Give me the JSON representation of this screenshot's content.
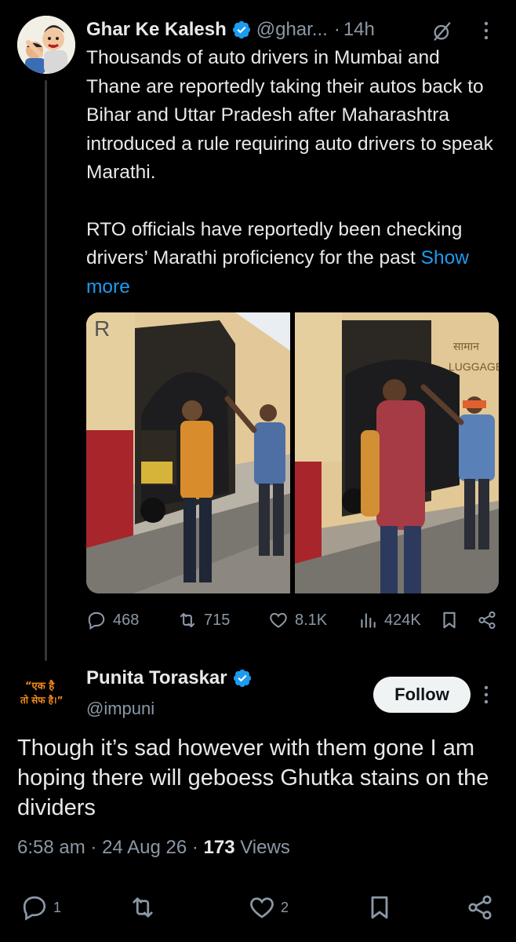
{
  "tweet": {
    "author_name": "Ghar Ke Kalesh",
    "handle": "@ghar...",
    "dot": "·",
    "time": "14h",
    "text_p1": "Thousands of auto drivers in Mumbai and Thane are reportedly taking their autos back to Bihar and Uttar Pradesh after Maharashtra introduced a rule requiring auto drivers to speak Marathi.",
    "text_p2": "RTO officials have reportedly been checking drivers’ Marathi proficiency for the past",
    "show_more": "Show more",
    "media_texts": {
      "left_corner_letter": "R",
      "right_sign_1": "सामान",
      "right_sign_2": "LUGGAGE"
    },
    "stats": {
      "replies": "468",
      "reposts": "715",
      "likes": "8.1K",
      "views": "424K"
    }
  },
  "reply": {
    "avatar_text_line1": "“एक है",
    "avatar_text_line2": "तो सेफ है।”",
    "author_name": "Punita Toraskar",
    "handle": "@impuni",
    "follow_label": "Follow",
    "text": "Though it’s sad however with them gone I am hoping there will geboess Ghutka stains on the dividers",
    "time": "6:58 am",
    "sep1": "·",
    "date": "24 Aug 26",
    "sep2": "·",
    "views_count": "173",
    "views_label": "Views",
    "stats": {
      "replies": "1",
      "likes": "2"
    }
  },
  "colors": {
    "background": "#000000",
    "text_primary": "#e7e9ea",
    "text_secondary": "#8b98a5",
    "link": "#1d9bf0",
    "verified": "#1d9bf0",
    "follow_bg": "#eff3f4"
  },
  "icons": {
    "verified": "verified-badge-icon",
    "grok": "grok-icon",
    "more": "more-vertical-icon",
    "reply": "reply-icon",
    "repost": "repost-icon",
    "like": "like-icon",
    "views": "views-icon",
    "bookmark": "bookmark-icon",
    "share": "share-icon"
  }
}
